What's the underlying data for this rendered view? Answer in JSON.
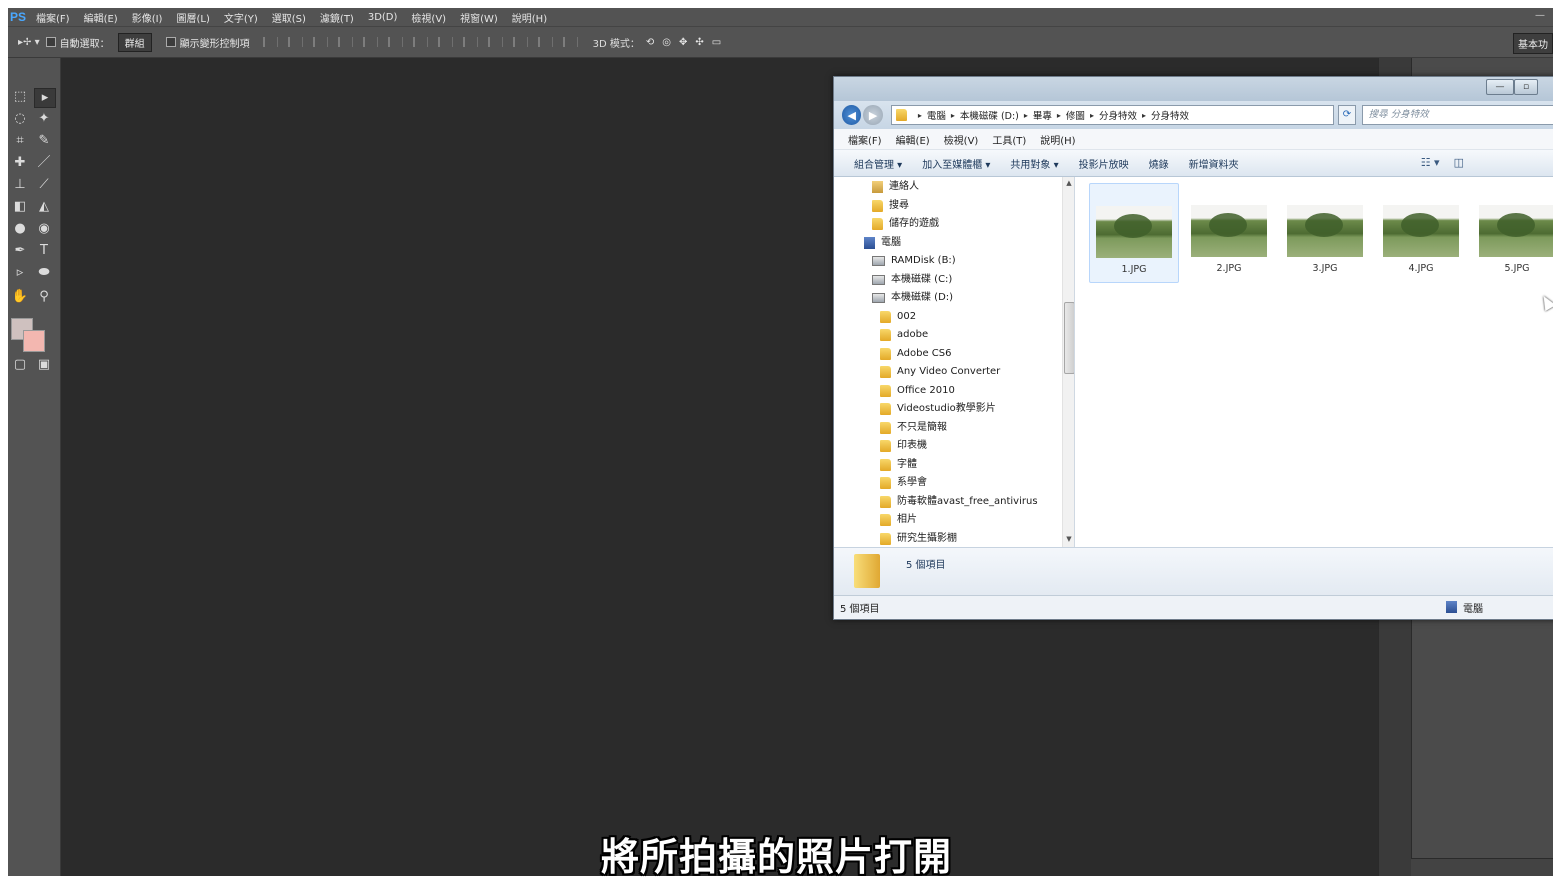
{
  "photoshop": {
    "logo": "PS",
    "menu": [
      "檔案(F)",
      "編輯(E)",
      "影像(I)",
      "圖層(L)",
      "文字(Y)",
      "選取(S)",
      "濾鏡(T)",
      "3D(D)",
      "檢視(V)",
      "視窗(W)",
      "說明(H)"
    ],
    "options": {
      "auto_select_label": "自動選取：",
      "auto_select_value": "群組",
      "show_transform_label": "顯示變形控制項",
      "mode3d_label": "3D 模式：",
      "workspace": "基本功"
    },
    "colors": {
      "foreground": "#cfc1bf",
      "background": "#f3b7b0"
    }
  },
  "explorer": {
    "breadcrumbs": [
      "電腦",
      "本機磁碟 (D:)",
      "畢專",
      "修圖",
      "分身特效",
      "分身特效"
    ],
    "search_placeholder": "搜尋 分身特效",
    "menu": [
      "檔案(F)",
      "編輯(E)",
      "檢視(V)",
      "工具(T)",
      "說明(H)"
    ],
    "commands": [
      "組合管理 ▾",
      "加入至媒體櫃 ▾",
      "共用對象 ▾",
      "投影片放映",
      "燒錄",
      "新增資料夾"
    ],
    "tree": [
      {
        "label": "連絡人",
        "icon": "contacts-icon",
        "indent": 1
      },
      {
        "label": "搜尋",
        "icon": "search-folder-icon",
        "indent": 1
      },
      {
        "label": "儲存的遊戲",
        "icon": "games-folder-icon",
        "indent": 1
      },
      {
        "label": "電腦",
        "icon": "computer-icon",
        "indent": 0
      },
      {
        "label": "RAMDisk (B:)",
        "icon": "drive-icon",
        "indent": 1
      },
      {
        "label": "本機磁碟 (C:)",
        "icon": "drive-icon",
        "indent": 1
      },
      {
        "label": "本機磁碟 (D:)",
        "icon": "drive-icon",
        "indent": 1
      },
      {
        "label": "002",
        "icon": "folder-icon",
        "indent": 2
      },
      {
        "label": "adobe",
        "icon": "folder-icon",
        "indent": 2
      },
      {
        "label": "Adobe CS6",
        "icon": "folder-icon",
        "indent": 2
      },
      {
        "label": "Any Video Converter",
        "icon": "folder-icon",
        "indent": 2
      },
      {
        "label": "Office 2010",
        "icon": "folder-icon",
        "indent": 2
      },
      {
        "label": "Videostudio教學影片",
        "icon": "folder-icon",
        "indent": 2
      },
      {
        "label": "不只是簡報",
        "icon": "folder-icon",
        "indent": 2
      },
      {
        "label": "印表機",
        "icon": "folder-icon",
        "indent": 2
      },
      {
        "label": "字體",
        "icon": "folder-icon",
        "indent": 2
      },
      {
        "label": "系學會",
        "icon": "folder-icon",
        "indent": 2
      },
      {
        "label": "防毒軟體avast_free_antivirus",
        "icon": "folder-icon",
        "indent": 2
      },
      {
        "label": "相片",
        "icon": "folder-icon",
        "indent": 2
      },
      {
        "label": "研究生攝影棚",
        "icon": "folder-icon",
        "indent": 2
      }
    ],
    "files": [
      "1.JPG",
      "2.JPG",
      "3.JPG",
      "4.JPG",
      "5.JPG"
    ],
    "item_count": "5 個項目",
    "status_left": "5 個項目",
    "status_right": "電腦"
  },
  "subtitle": "將所拍攝的照片打開"
}
